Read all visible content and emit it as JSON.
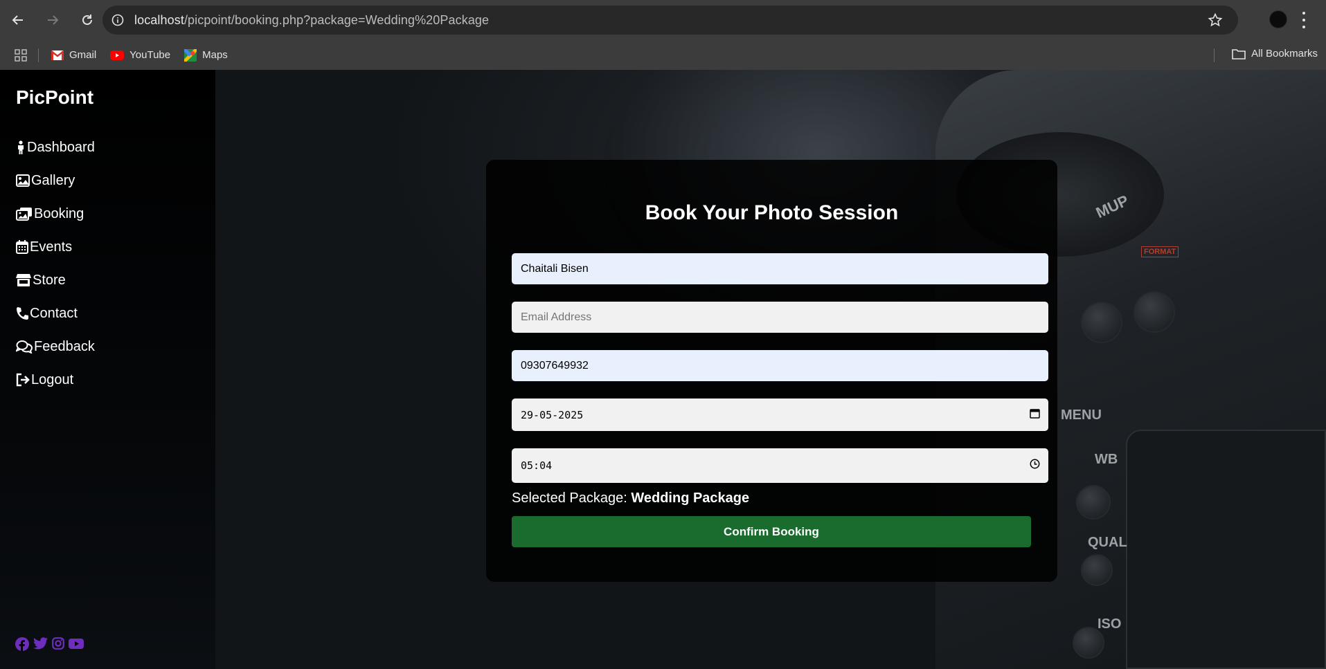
{
  "browser": {
    "url_host": "localhost",
    "url_path": "/picpoint/booking.php?package=Wedding%20Package",
    "bookmarks": [
      {
        "label": "Gmail",
        "icon": "gmail-icon"
      },
      {
        "label": "YouTube",
        "icon": "youtube-icon"
      },
      {
        "label": "Maps",
        "icon": "maps-icon"
      }
    ],
    "all_bookmarks_label": "All Bookmarks"
  },
  "sidebar": {
    "brand": "PicPoint",
    "items": [
      {
        "label": "Dashboard",
        "icon": "person-icon"
      },
      {
        "label": "Gallery",
        "icon": "image-icon"
      },
      {
        "label": "Booking",
        "icon": "images-icon"
      },
      {
        "label": "Events",
        "icon": "calendar-icon"
      },
      {
        "label": "Store",
        "icon": "store-icon"
      },
      {
        "label": "Contact",
        "icon": "phone-icon"
      },
      {
        "label": "Feedback",
        "icon": "chat-icon"
      },
      {
        "label": "Logout",
        "icon": "logout-icon"
      }
    ],
    "social": [
      "facebook-icon",
      "twitter-icon",
      "instagram-icon",
      "youtube-icon"
    ],
    "social_color": "#6f2dbd"
  },
  "camera_labels": {
    "menu": "MENU",
    "wb": "WB",
    "qual": "QUAL",
    "iso": "ISO",
    "format": "FORMAT",
    "mup": "MUP"
  },
  "form": {
    "title": "Book Your Photo Session",
    "name_value": "Chaitali Bisen",
    "email_placeholder": "Email Address",
    "phone_value": "09307649932",
    "date_value": "29-05-2025",
    "time_value": "05:04",
    "package_label": "Selected Package:",
    "package_value": "Wedding Package",
    "confirm_label": "Confirm Booking",
    "confirm_color": "#1a6b2e"
  }
}
